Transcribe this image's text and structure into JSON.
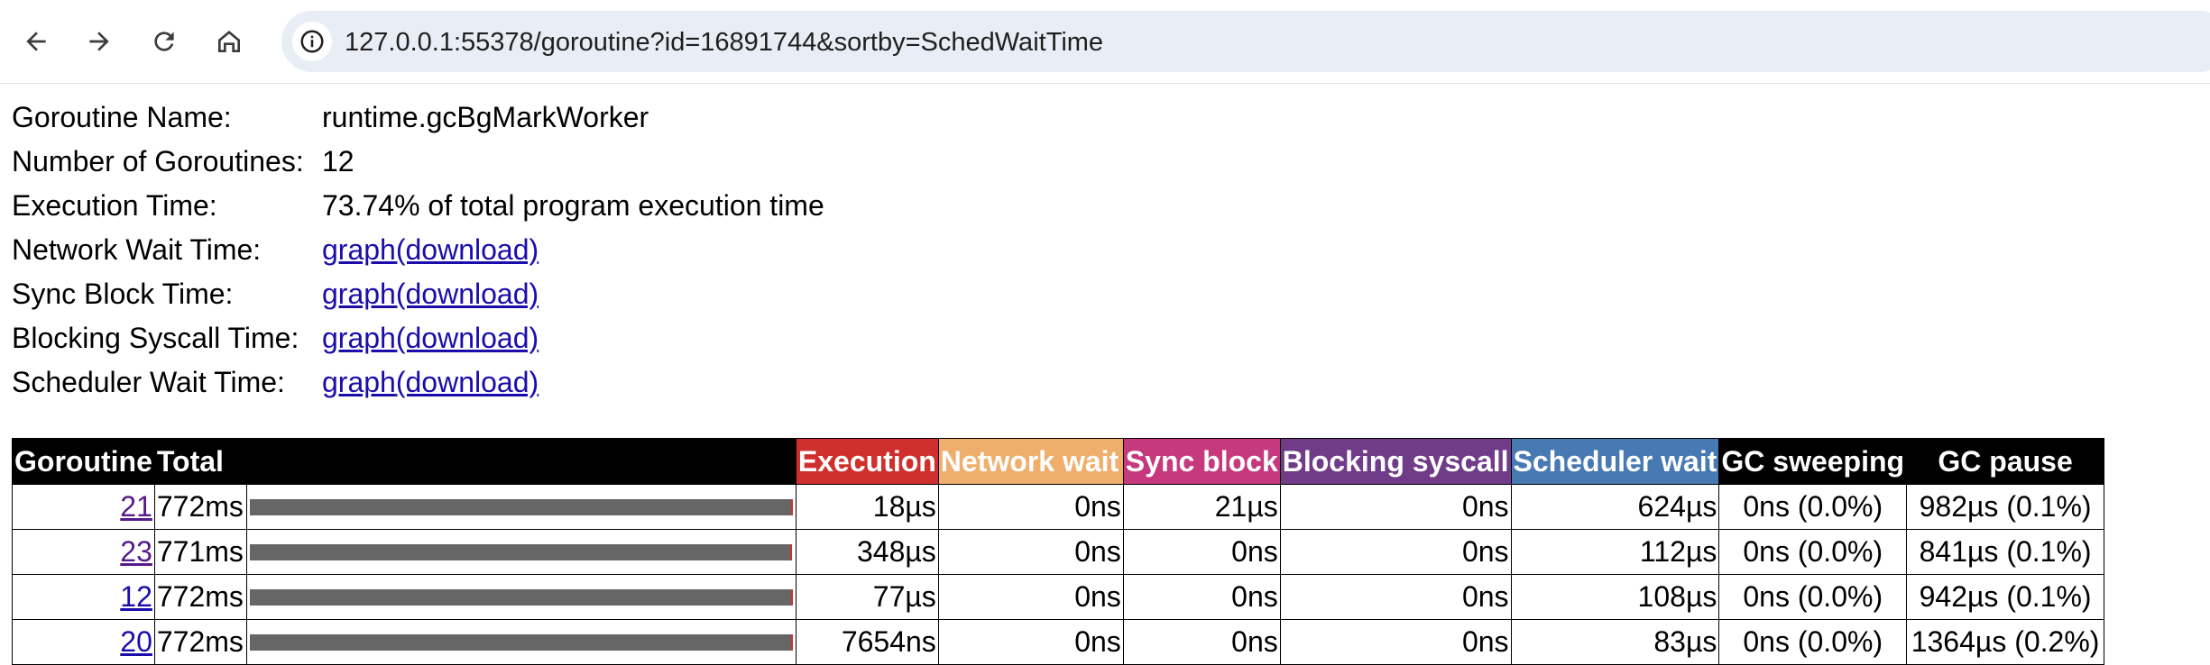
{
  "browser": {
    "url": "127.0.0.1:55378/goroutine?id=16891744&sortby=SchedWaitTime"
  },
  "info": [
    {
      "label": "Goroutine Name:",
      "value": "runtime.gcBgMarkWorker",
      "type": "text"
    },
    {
      "label": "Number of Goroutines:",
      "value": "12",
      "type": "text"
    },
    {
      "label": "Execution Time:",
      "value": "73.74% of total program execution time",
      "type": "text"
    },
    {
      "label": "Network Wait Time:",
      "link1": "graph",
      "link2": "(download)",
      "type": "links"
    },
    {
      "label": "Sync Block Time:",
      "link1": "graph",
      "link2": "(download)",
      "type": "links"
    },
    {
      "label": "Blocking Syscall Time:",
      "link1": "graph",
      "link2": "(download)",
      "type": "links"
    },
    {
      "label": "Scheduler Wait Time:",
      "link1": "graph",
      "link2": "(download)",
      "type": "links"
    }
  ],
  "table": {
    "headers": [
      {
        "label": "Goroutine",
        "color": "#000000"
      },
      {
        "label": "Total",
        "color": "#000000"
      },
      {
        "label": "",
        "color": "#000000"
      },
      {
        "label": "Execution",
        "color": "#d0302d"
      },
      {
        "label": "Network wait",
        "color": "#efae6c"
      },
      {
        "label": "Sync block",
        "color": "#c6397e"
      },
      {
        "label": "Blocking syscall",
        "color": "#703c88"
      },
      {
        "label": "Scheduler wait",
        "color": "#4779b3"
      },
      {
        "label": "GC sweeping",
        "color": "#000000"
      },
      {
        "label": "GC pause",
        "color": "#000000"
      }
    ],
    "rows": [
      {
        "id": "21",
        "total": "772ms",
        "bar_fraction": 1.0,
        "execution": "18µs",
        "network": "0ns",
        "sync": "21µs",
        "syscall": "0ns",
        "sched": "624µs",
        "sweep": "0ns (0.0%)",
        "pause": "982µs (0.1%)"
      },
      {
        "id": "23",
        "total": "771ms",
        "bar_fraction": 0.999,
        "execution": "348µs",
        "network": "0ns",
        "sync": "0ns",
        "syscall": "0ns",
        "sched": "112µs",
        "sweep": "0ns (0.0%)",
        "pause": "841µs (0.1%)"
      },
      {
        "id": "12",
        "total": "772ms",
        "bar_fraction": 1.0,
        "execution": "77µs",
        "network": "0ns",
        "sync": "0ns",
        "syscall": "0ns",
        "sched": "108µs",
        "sweep": "0ns (0.0%)",
        "pause": "942µs (0.1%)"
      },
      {
        "id": "20",
        "total": "772ms",
        "bar_fraction": 1.0,
        "execution": "7654ns",
        "network": "0ns",
        "sync": "0ns",
        "syscall": "0ns",
        "sched": "83µs",
        "sweep": "0ns (0.0%)",
        "pause": "1364µs (0.2%)"
      }
    ]
  }
}
